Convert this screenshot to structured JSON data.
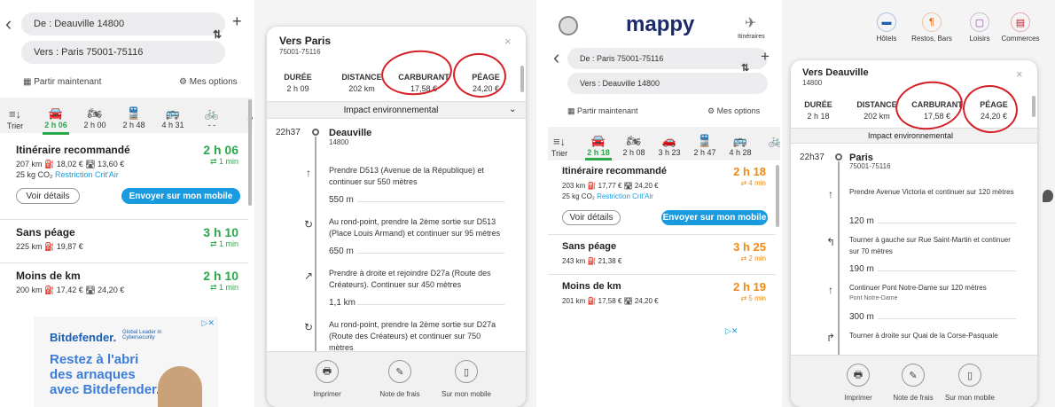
{
  "colors": {
    "green": "#2aa84a",
    "orange": "#ee8a14",
    "blue": "#1a9be0",
    "red": "#d42026"
  },
  "left": {
    "from": "De : Deauville 14800",
    "to": "Vers : Paris 75001-75116",
    "depart": "Partir maintenant",
    "options": "Mes options",
    "sort": "Trier",
    "tabs": [
      {
        "label": "2 h 06",
        "icon": "car-icon"
      },
      {
        "label": "2 h 00",
        "icon": "motorbike-icon"
      },
      {
        "label": "2 h 48",
        "icon": "train-icon"
      },
      {
        "label": "4 h 31",
        "icon": "bus-icon"
      },
      {
        "label": "- -",
        "icon": "bike-icon"
      },
      {
        "label": "",
        "icon": "walk-icon"
      }
    ],
    "routes": [
      {
        "title": "Itinéraire recommandé",
        "time": "2 h 06",
        "sub": "207 km ⛽ 18,02 € 🛣 13,60 €",
        "delay": "⇄ 1 min",
        "co2": "25 kg CO₂",
        "critair": "Restriction Crit'Air"
      },
      {
        "title": "Sans péage",
        "time": "3 h 10",
        "sub": "225 km ⛽ 19,87 €",
        "delay": "⇄ 1 min"
      },
      {
        "title": "Moins de km",
        "time": "2 h 10",
        "sub": "200 km ⛽ 17,42 € 🛣 24,20 €",
        "delay": "⇄ 1 min"
      }
    ],
    "details": "Voir détails",
    "send": "Envoyer sur mon mobile",
    "ad": {
      "brand": "Bitdefender.",
      "tag": "Global Leader in Cybersecurity",
      "l1": "Restez à l'abri",
      "l2": "des arnaques",
      "l3": "avec Bitdefender."
    }
  },
  "lcard": {
    "title": "Vers Paris",
    "sub": "75001-75116",
    "stats": [
      {
        "label": "DURÉE",
        "value": "2 h 09"
      },
      {
        "label": "DISTANCE",
        "value": "202 km"
      },
      {
        "label": "CARBURANT",
        "value": "17,58 €"
      },
      {
        "label": "PÉAGE",
        "value": "24,20 €"
      }
    ],
    "impact": "Impact environnemental",
    "start_time": "22h37",
    "start_place": "Deauville",
    "start_zip": "14800",
    "steps": [
      {
        "text": "Prendre D513 (Avenue de la République) et continuer sur 550 mètres",
        "dist": "550 m",
        "icon": "straight-arrow-icon"
      },
      {
        "text": "Au rond-point, prendre la 2ème sortie sur D513 (Place Louis Armand) et continuer sur 95 mètres",
        "dist": "650 m",
        "icon": "roundabout-icon"
      },
      {
        "text": "Prendre à droite et rejoindre D27a (Route des Créateurs). Continuer sur 450 mètres",
        "dist": "1,1 km",
        "icon": "right-merge-icon"
      },
      {
        "text": "Au rond-point, prendre la 2ème sortie sur D27a (Route des Créateurs) et continuer sur 750 mètres",
        "dist": "",
        "icon": "roundabout-icon"
      }
    ],
    "footer": [
      "Imprimer",
      "Note de frais",
      "Sur mon mobile"
    ]
  },
  "right": {
    "logo": "mappy",
    "itin": "Itinéraires",
    "from": "De : Paris 75001-75116",
    "to": "Vers : Deauville 14800",
    "depart": "Partir maintenant",
    "options": "Mes options",
    "sort": "Trier",
    "tabs": [
      {
        "label": "2 h 18",
        "icon": "car-icon"
      },
      {
        "label": "2 h 08",
        "icon": "motorbike-icon"
      },
      {
        "label": "3 h 23",
        "icon": "car2-icon"
      },
      {
        "label": "2 h 47",
        "icon": "train-icon"
      },
      {
        "label": "4 h 28",
        "icon": "bus-icon"
      },
      {
        "label": "",
        "icon": "bike-icon"
      }
    ],
    "routes": [
      {
        "title": "Itinéraire recommandé",
        "time": "2 h 18",
        "sub": "203 km ⛽ 17,77 € 🛣 24,20 €",
        "delay": "⇄ 4 min",
        "co2": "25 kg CO₂",
        "critair": "Restriction Crit'Air"
      },
      {
        "title": "Sans péage",
        "time": "3 h 25",
        "sub": "243 km ⛽ 21,38 €",
        "delay": "⇄ 2 min"
      },
      {
        "title": "Moins de km",
        "time": "2 h 19",
        "sub": "201 km ⛽ 17,58 € 🛣 24,20 €",
        "delay": "⇄ 5 min"
      }
    ],
    "details": "Voir détails",
    "send": "Envoyer sur mon mobile",
    "top": [
      {
        "label": "Hôtels",
        "icon": "hotel-icon",
        "color": "#1a5fb4"
      },
      {
        "label": "Restos, Bars",
        "icon": "restaurant-icon",
        "color": "#e66100"
      },
      {
        "label": "Loisirs",
        "icon": "leisure-icon",
        "color": "#9141ac"
      },
      {
        "label": "Commerces",
        "icon": "shop-icon",
        "color": "#c01c28"
      }
    ]
  },
  "rcard": {
    "title": "Vers Deauville",
    "sub": "14800",
    "stats": [
      {
        "label": "DURÉE",
        "value": "2 h 18"
      },
      {
        "label": "DISTANCE",
        "value": "202 km"
      },
      {
        "label": "CARBURANT",
        "value": "17,58 €"
      },
      {
        "label": "PÉAGE",
        "value": "24,20 €"
      }
    ],
    "impact": "Impact environnemental",
    "start_time": "22h37",
    "start_place": "Paris",
    "start_zip": "75001-75116",
    "steps": [
      {
        "text": "Prendre Avenue Victoria et continuer sur 120 mètres",
        "dist": "120 m",
        "icon": "straight-arrow-icon"
      },
      {
        "text": "Tourner à gauche sur Rue Saint-Martin et continuer sur 70 mètres",
        "dist": "190 m",
        "icon": "turn-left-icon"
      },
      {
        "text": "Continuer Pont Notre-Dame sur 120 mètres",
        "sub": "Pont Notre-Dame",
        "dist": "300 m",
        "icon": "straight-arrow-icon"
      },
      {
        "text": "Tourner à droite sur Quai de la Corse-Pasquale",
        "dist": "",
        "icon": "turn-right-icon"
      }
    ],
    "footer": [
      "Imprimer",
      "Note de frais",
      "Sur mon mobile"
    ]
  }
}
